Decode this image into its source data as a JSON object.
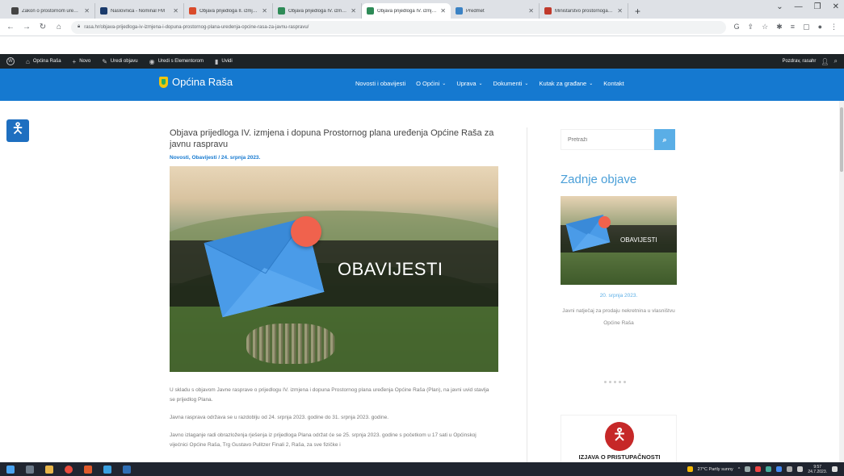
{
  "browser": {
    "tabs": [
      {
        "title": "Zakon o prostornom uređenju",
        "color": "#444444"
      },
      {
        "title": "Naslovnica - Nominal FM",
        "color": "#1a3a6b"
      },
      {
        "title": "Objava prijedloga II. izmjena i d...",
        "color": "#d94b2b"
      },
      {
        "title": "Objava prijedloga IV. izmjena i d...",
        "color": "#2e8b57"
      },
      {
        "title": "Objava prijedloga IV. izmjena i d...",
        "color": "#2e8b57",
        "active": true
      },
      {
        "title": "Predmet",
        "color": "#3b82c4"
      },
      {
        "title": "Ministarstvo prostornoga uređ...",
        "color": "#c0392b"
      }
    ],
    "new_tab": "+",
    "url": "rasa.hr/objava-prijedloga-iv-izmjena-i-dopuna-prostornog-plana-uredenja-opcine-rasa-za-javnu-raspravu/"
  },
  "wpbar": {
    "site": "Općina Raša",
    "new": "Novo",
    "edit": "Uredi objavu",
    "elementor": "Uredi s Elementorom",
    "insights": "Uvidi",
    "greeting": "Pozdrav, rasahr"
  },
  "site": {
    "brand": "Općina Raša",
    "menu": [
      {
        "label": "Novosti i obavijesti",
        "dropdown": false
      },
      {
        "label": "O Općini",
        "dropdown": true
      },
      {
        "label": "Uprava",
        "dropdown": true
      },
      {
        "label": "Dokumenti",
        "dropdown": true
      },
      {
        "label": "Kutak za građane",
        "dropdown": true
      },
      {
        "label": "Kontakt",
        "dropdown": false
      }
    ]
  },
  "article": {
    "title": "Objava prijedloga IV. izmjena i dopuna Prostornog plana uređenja Općine Raša za javnu raspravu",
    "meta": "Novosti, Obavijesti / 24. srpnja 2023.",
    "hero_label": "OBAVIJESTI",
    "paragraphs": [
      "U skladu s objavom Javne rasprave o prijedlogu IV. izmjena i dopuna Prostornog plana uređenja Općine Raša (Plan), na javni uvid stavlja se prijedlog Plana.",
      "Javna rasprava održava se u razdoblju od 24. srpnja 2023. godine do 31. srpnja 2023. godine.",
      "Javno izlaganje radi obrazloženja rješenja iz prijedloga Plana održat će se 25. srpnja 2023. godine s početkom u 17 sati u Općinskoj vijećnici Općine Raša, Trg Gustavo Pulitzer Finali 2, Raša, za sve fizičke i"
    ]
  },
  "sidebar": {
    "search_placeholder": "Pretraži",
    "heading": "Zadnje objave",
    "thumb_label": "OBAVIJESTI",
    "date": "20. srpnja 2023.",
    "excerpt": "Javni natječaj za prodaju nekretnina u vlasništvu Općine Raša",
    "a11y_label": "IZJAVA O PRISTUPAČNOSTI"
  },
  "taskbar": {
    "weather": "27°C Partly sunny",
    "time": "9:57",
    "date": "24.7.2023."
  },
  "colors": {
    "brand_blue": "#1579d0",
    "accent": "#4a9fd8",
    "dot": "#f0624d"
  }
}
